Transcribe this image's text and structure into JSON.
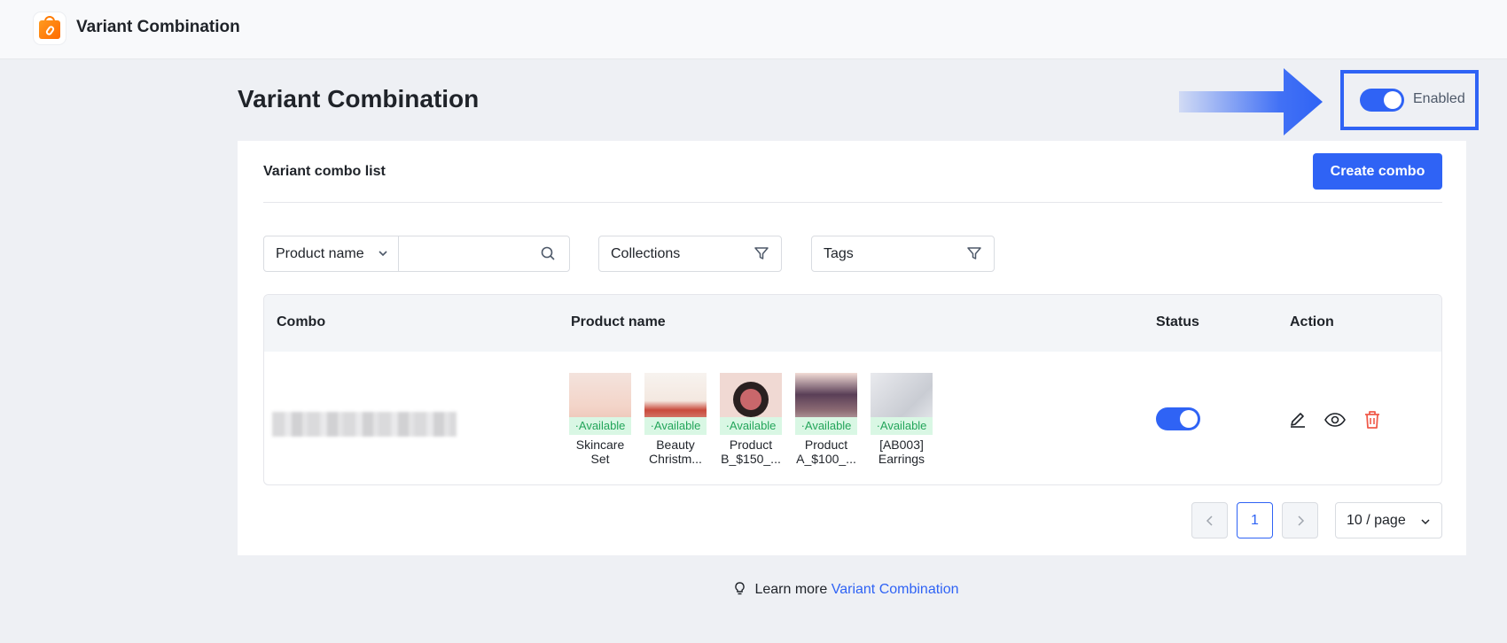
{
  "header": {
    "app_title": "Variant Combination"
  },
  "page": {
    "title": "Variant Combination",
    "enable_label": "Enabled",
    "enabled": true
  },
  "card": {
    "title": "Variant combo list",
    "create_button": "Create combo"
  },
  "filters": {
    "product_select": "Product name",
    "search_placeholder": "",
    "collections": "Collections",
    "tags": "Tags"
  },
  "table": {
    "columns": {
      "combo": "Combo",
      "product_name": "Product name",
      "status": "Status",
      "action": "Action"
    },
    "rows": [
      {
        "combo_name_blurred": true,
        "status_enabled": true,
        "products": [
          {
            "badge": "·Available",
            "name": "Skincare Set"
          },
          {
            "badge": "·Available",
            "name": "Beauty Christm..."
          },
          {
            "badge": "·Available",
            "name": "Product B_$150_..."
          },
          {
            "badge": "·Available",
            "name": "Product A_$100_..."
          },
          {
            "badge": "·Available",
            "name": "[AB003] Earrings"
          }
        ]
      }
    ]
  },
  "pagination": {
    "current_page": "1",
    "page_size": "10 / page"
  },
  "footer": {
    "prefix": "Learn more",
    "link": "Variant Combination"
  },
  "colors": {
    "accent": "#2f63f5",
    "available_text": "#23a55a",
    "available_bg": "#d9f7e4",
    "delete": "#f05a4a"
  }
}
